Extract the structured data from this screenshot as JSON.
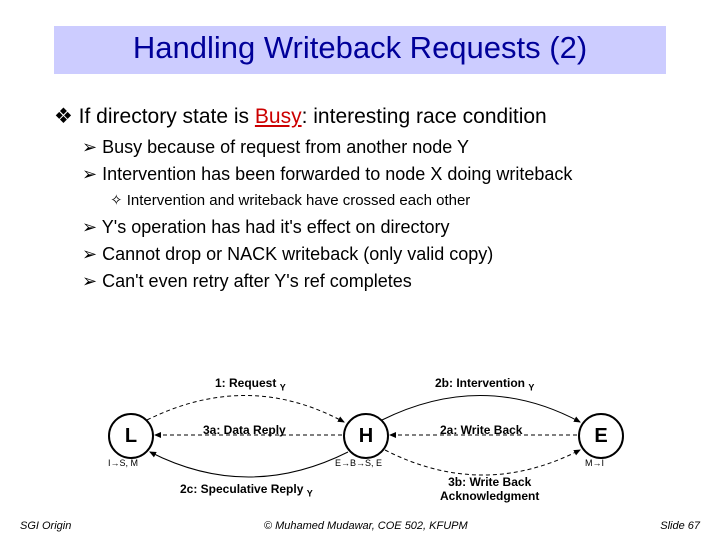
{
  "title": "Handling Writeback Requests (2)",
  "bullets": {
    "b1_pre": "If directory state is ",
    "b1_busy": "Busy",
    "b1_post": ": interesting race condition",
    "b2": "Busy because of request from another node Y",
    "b3": "Intervention has been forwarded to node X doing writeback",
    "b4": "Intervention and writeback have crossed each other",
    "b5": "Y's operation has had it's effect on directory",
    "b6": "Cannot drop or NACK writeback (only valid copy)",
    "b7": "Can't even retry after Y's ref completes"
  },
  "diagram": {
    "nodeL": "L",
    "nodeH": "H",
    "nodeE": "E",
    "tagL": "I→S, M",
    "tagH": "E→B→S, E",
    "tagE": "M→I",
    "lbl_top_left_pre": "1: Request ",
    "lbl_top_left_sub": "Y",
    "lbl_mid_left": "3a: Data Reply",
    "lbl_top_right_pre": "2b: Intervention ",
    "lbl_top_right_sub": "Y",
    "lbl_mid_right": "2a: Write Back",
    "lbl_bot_left_pre": "2c: Speculative Reply ",
    "lbl_bot_left_sub": "Y",
    "lbl_bot_right_l1": "3b: Write Back",
    "lbl_bot_right_l2": "Acknowledgment"
  },
  "footer": {
    "left": "SGI Origin",
    "center": "© Muhamed Mudawar, COE 502, KFUPM",
    "right": "Slide 67"
  }
}
